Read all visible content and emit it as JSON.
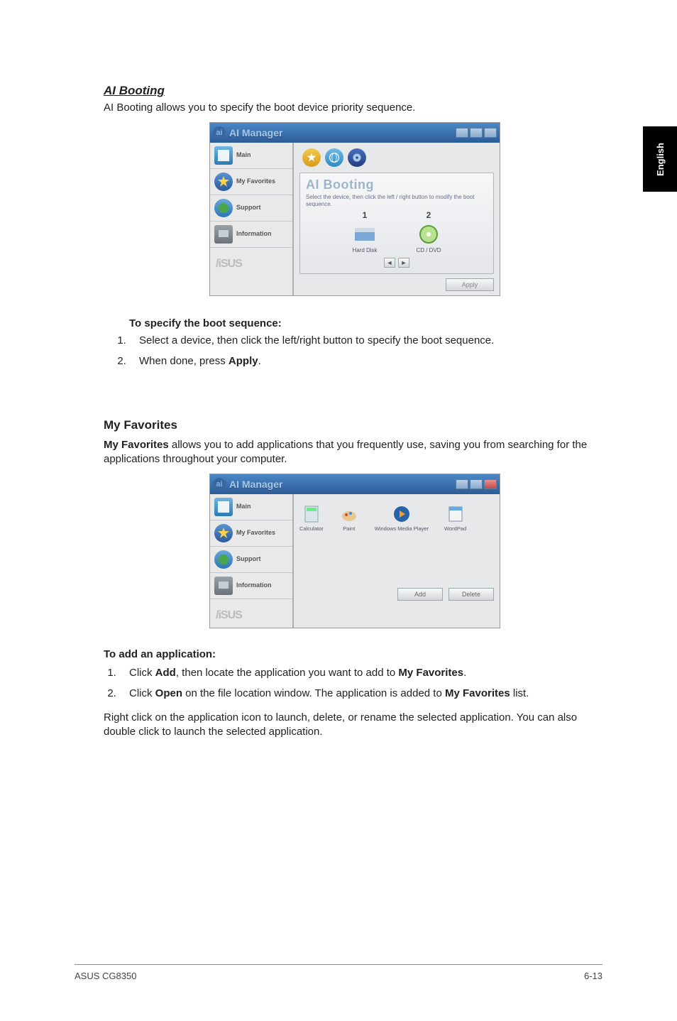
{
  "side_tab": "English",
  "ai_booting": {
    "title": "AI Booting",
    "intro": "AI Booting allows you to specify the boot device priority sequence.",
    "window": {
      "logo_letter": "ai",
      "title": "AI Manager",
      "sidebar": {
        "items": [
          {
            "label": "Main"
          },
          {
            "label": "My Favorites"
          },
          {
            "label": "Support"
          },
          {
            "label": "Information"
          }
        ],
        "footer": "/iSUS"
      },
      "panel": {
        "title": "AI Booting",
        "desc": "Select the device, then click the left / right button to modify the boot sequence.",
        "slots": [
          {
            "num": "1",
            "label": "Hard Disk"
          },
          {
            "num": "2",
            "label": "CD / DVD"
          }
        ],
        "arrows": {
          "left": "◄",
          "right": "►"
        },
        "apply": "Apply"
      }
    },
    "subheading": "To specify the boot sequence:",
    "steps": [
      "Select a device, then click the left/right button to specify the boot sequence.",
      {
        "pre": "When done, press ",
        "bold": "Apply",
        "post": "."
      }
    ]
  },
  "my_favorites": {
    "heading": "My Favorites",
    "intro": {
      "bold": "My Favorites",
      "rest": " allows you to add applications that you frequently use, saving you from searching for the applications throughout your computer."
    },
    "window": {
      "logo_letter": "ai",
      "title": "AI Manager",
      "sidebar": {
        "items": [
          {
            "label": "Main"
          },
          {
            "label": "My Favorites"
          },
          {
            "label": "Support"
          },
          {
            "label": "Information"
          }
        ],
        "footer": "/iSUS"
      },
      "favorites": [
        {
          "label": "Calculator"
        },
        {
          "label": "Paint"
        },
        {
          "label": "Windows Media Player"
        },
        {
          "label": "WordPad"
        }
      ],
      "buttons": {
        "add": "Add",
        "delete": "Delete"
      }
    },
    "subheading": "To add an application:",
    "steps": [
      {
        "pre": "Click ",
        "b1": "Add",
        "mid": ", then locate the application you want to add to ",
        "b2": "My Favorites",
        "post": "."
      },
      {
        "pre": "Click ",
        "b1": "Open",
        "mid": " on the file location window. The application is added to ",
        "b2": "My Favorites",
        "post": " list."
      }
    ],
    "closing": "Right click on the application icon to launch, delete, or rename the selected application. You can also double click to launch the selected application."
  },
  "footer": {
    "left": "ASUS CG8350",
    "right": "6-13"
  }
}
